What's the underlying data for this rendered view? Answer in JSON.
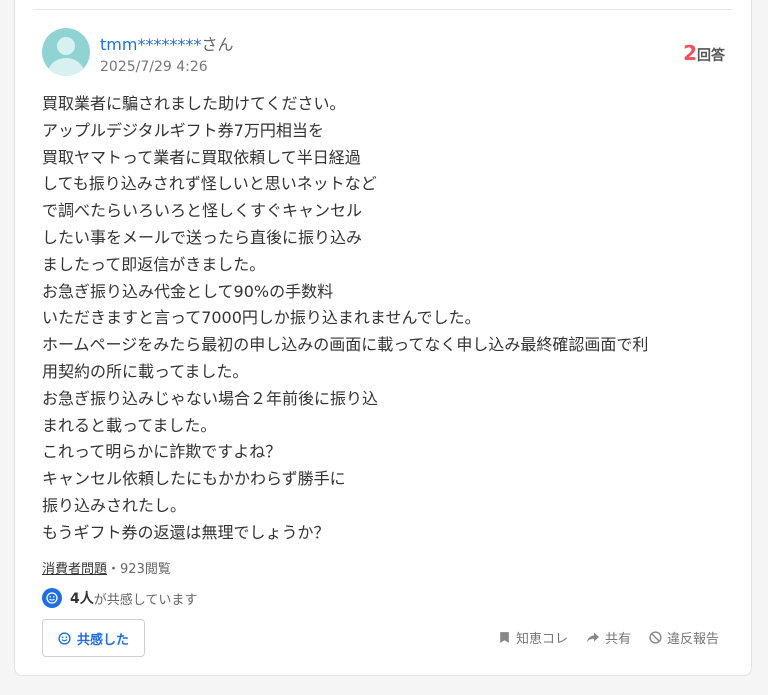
{
  "user": {
    "name": "tmm********",
    "suffix": "さん",
    "timestamp": "2025/7/29 4:26"
  },
  "answers": {
    "count": "2",
    "label": "回答"
  },
  "question_lines": [
    "買取業者に騙されました助けてください。",
    "アップルデジタルギフト券7万円相当を",
    "買取ヤマトって業者に買取依頼して半日経過",
    "しても振り込みされず怪しいと思いネットなど",
    "で調べたらいろいろと怪しくすぐキャンセル",
    "したい事をメールで送ったら直後に振り込み",
    "ましたって即返信がきました。",
    "お急ぎ振り込み代金として90%の手数料",
    "いただきますと言って7000円しか振り込まれませんでした。",
    "ホームページをみたら最初の申し込みの画面に載ってなく申し込み最終確認画面で利",
    "用契約の所に載ってました。",
    "お急ぎ振り込みじゃない場合２年前後に振り込",
    "まれると載ってました。",
    "これって明らかに詐欺ですよね？",
    "キャンセル依頼したにもかかわらず勝手に",
    "振り込みされたし。",
    "もうギフト券の返還は無理でしょうか？"
  ],
  "meta": {
    "category": "消費者問題",
    "separator": "・",
    "views": "923閲覧"
  },
  "empathy": {
    "count": "4人",
    "text": "が共感しています",
    "button_label": "共感した"
  },
  "actions": {
    "save": "知恵コレ",
    "share": "共有",
    "report": "違反報告"
  },
  "colors": {
    "accent_blue": "#1f6fe3",
    "link_blue": "#1a73e8",
    "answer_red": "#f0525d",
    "avatar_teal": "#8fd3d3"
  }
}
